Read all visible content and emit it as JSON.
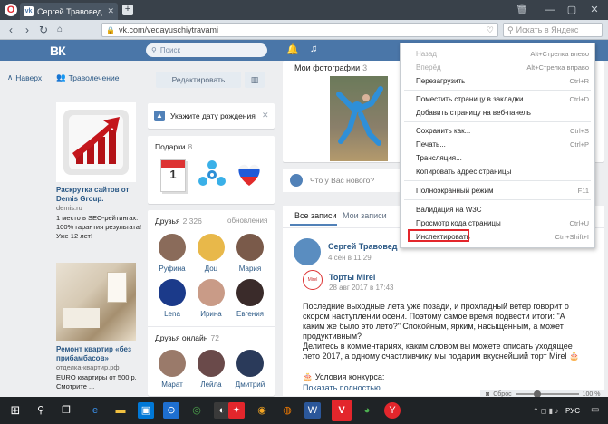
{
  "browser": {
    "tab_title": "Сергей Травовед",
    "tab_icon": "vk-icon",
    "new_tab": "+",
    "url": "vk.com/vedayuschiytravami",
    "search_placeholder": "Искать в Яндекс"
  },
  "vk_header": {
    "logo": "ВК",
    "search_placeholder": "Поиск"
  },
  "left_nav": {
    "back": "Наверх",
    "herb": "Траволечение"
  },
  "ads": [
    {
      "title": "Раскрутка сайтов от Demis Group.",
      "domain": "demis.ru",
      "text": "1 место в SEO-рейтингах. 100% гарантия результата! Уже 12 лет!"
    },
    {
      "title": "Ремонт квартир «без прибамбасов»",
      "domain": "отделка-квартир.рф",
      "text": "EURO квартиры от 500 р. Смотрите ..."
    }
  ],
  "profile": {
    "edit_label": "Редактировать",
    "stats_icon": "chart-icon",
    "birthday_label": "Укажите дату рождения",
    "gifts_title": "Подарки",
    "gifts_count": "8",
    "friends_title": "Друзья",
    "friends_count": "2 326",
    "updates_label": "обновления",
    "friends": [
      {
        "name": "Руфина",
        "color": "#8a6b5a"
      },
      {
        "name": "Доц",
        "color": "#e8b84a"
      },
      {
        "name": "Мария",
        "color": "#7a5a4a"
      },
      {
        "name": "Lena",
        "color": "#1b3a8a"
      },
      {
        "name": "Ирина",
        "color": "#c99b87"
      },
      {
        "name": "Евгения",
        "color": "#3a2b2a"
      }
    ],
    "online_title": "Друзья онлайн",
    "online_count": "72",
    "online_friends": [
      {
        "name": "Марат",
        "color": "#9a7a6a"
      },
      {
        "name": "Лейла",
        "color": "#6a4a4a"
      },
      {
        "name": "Дмитрий",
        "color": "#2a3a5a"
      }
    ]
  },
  "photos": {
    "title": "Мои фотографии",
    "count": "3"
  },
  "post_prompt": "Что у Вас нового?",
  "wall": {
    "tab_all": "Все записи",
    "tab_mine": "Мои записи",
    "author": "Сергей Травовед",
    "date": "4 сен в 11:29",
    "repost_author": "Торты Mirel",
    "repost_date": "28 авг 2017 в 17:43",
    "text1": "Последние выходные лета уже позади, и прохладный ветер говорит о скором наступлении осени. Поэтому самое время подвести итоги: \"А каким же было это лето?\" Спокойным, ярким, насыщенным, а может продуктивным?",
    "text2": "Делитесь в комментариях, каким словом вы можете описать уходящее лето 2017, а одному счастливчику мы подарим вкуснейший торт Mirel 🎂",
    "contest": "Условия конкурса:",
    "show_more": "Показать полностью..."
  },
  "context_menu": {
    "items": [
      {
        "label": "Назад",
        "shortcut": "Alt+Стрелка влево",
        "disabled": true
      },
      {
        "label": "Вперёд",
        "shortcut": "Alt+Стрелка вправо",
        "disabled": true
      },
      {
        "label": "Перезагрузить",
        "shortcut": "Ctrl+R",
        "disabled": false
      },
      {
        "label": "Поместить страницу в закладки",
        "shortcut": "Ctrl+D",
        "disabled": false
      },
      {
        "label": "Добавить страницу на веб-панель",
        "shortcut": "",
        "disabled": false
      },
      {
        "label": "Сохранить как...",
        "shortcut": "Ctrl+S",
        "disabled": false
      },
      {
        "label": "Печать...",
        "shortcut": "Ctrl+P",
        "disabled": false
      },
      {
        "label": "Трансляция...",
        "shortcut": "",
        "disabled": false
      },
      {
        "label": "Копировать адрес страницы",
        "shortcut": "",
        "disabled": false
      },
      {
        "label": "Полноэкранный режим",
        "shortcut": "F11",
        "disabled": false
      },
      {
        "label": "Валидация на W3C",
        "shortcut": "",
        "disabled": false
      },
      {
        "label": "Просмотр кода страницы",
        "shortcut": "Ctrl+U",
        "disabled": false
      },
      {
        "label": "Инспектировать",
        "shortcut": "Ctrl+Shift+I",
        "disabled": false
      }
    ]
  },
  "statusbar": {
    "reset": "Сброс",
    "zoom": "100 %"
  },
  "taskbar": {
    "lang": "РУС",
    "brand_color": "#e3262c"
  }
}
